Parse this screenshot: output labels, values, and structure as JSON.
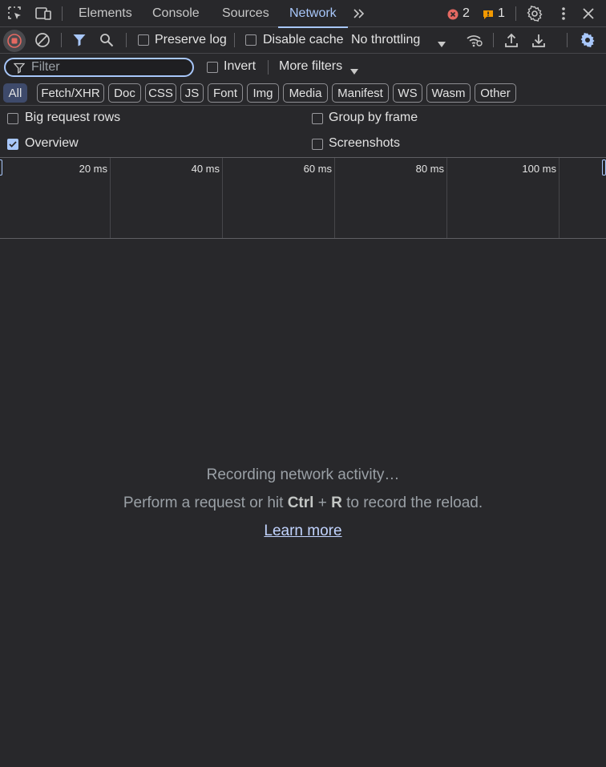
{
  "tabbar": {
    "tabs": [
      {
        "label": "Elements"
      },
      {
        "label": "Console"
      },
      {
        "label": "Sources"
      },
      {
        "label": "Network",
        "active": true
      }
    ],
    "more_tabs_icon": "chevron-double-right-icon",
    "error_count": "2",
    "warning_count": "1"
  },
  "toolbar": {
    "preserve_log": "Preserve log",
    "disable_cache": "Disable cache",
    "throttling": "No throttling"
  },
  "filter": {
    "placeholder": "Filter",
    "invert": "Invert",
    "more_filters": "More filters"
  },
  "type_filters": [
    "All",
    "Fetch/XHR",
    "Doc",
    "CSS",
    "JS",
    "Font",
    "Img",
    "Media",
    "Manifest",
    "WS",
    "Wasm",
    "Other"
  ],
  "settings": {
    "big_request_rows": "Big request rows",
    "group_by_frame": "Group by frame",
    "overview": "Overview",
    "screenshots": "Screenshots",
    "overview_checked": true
  },
  "timeline": {
    "ticks": [
      "20 ms",
      "40 ms",
      "60 ms",
      "80 ms",
      "100 ms"
    ]
  },
  "empty_state": {
    "line1": "Recording network activity…",
    "line2_prefix": "Perform a request or hit ",
    "shortcut_ctrl": "Ctrl",
    "shortcut_plus": " + ",
    "shortcut_r": "R",
    "line2_suffix": " to record the reload.",
    "learn_more": "Learn more"
  },
  "colors": {
    "accent": "#a8c7fa",
    "background": "#28282b",
    "record_red": "#e46962",
    "error_red": "#e46962",
    "warning_orange": "#f29900"
  }
}
